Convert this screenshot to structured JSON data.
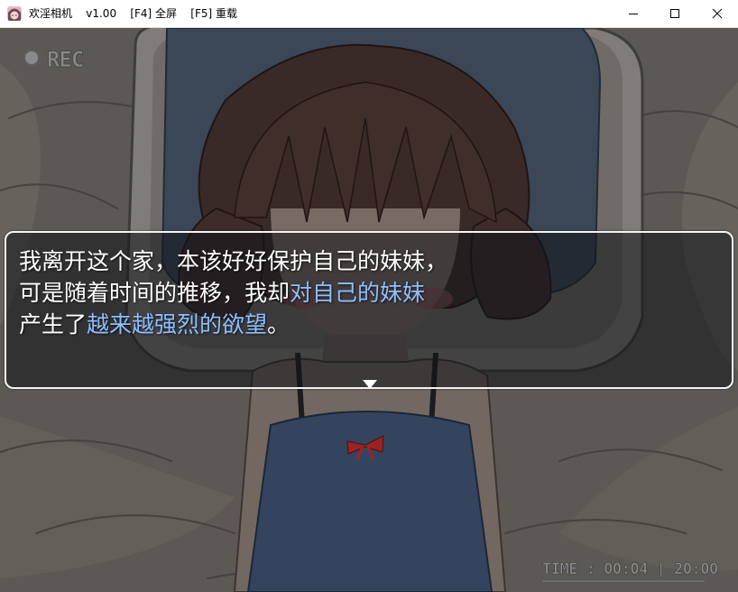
{
  "window": {
    "title": "欢淫相机    v1.00    [F4] 全屏    [F5] 重载",
    "controls": [
      "minimize",
      "maximize",
      "close"
    ],
    "app_icon": "anime-character-icon"
  },
  "hud": {
    "rec_indicator": "REC",
    "time_label": "TIME : 00:04 | 20:00"
  },
  "dialog": {
    "line1": "我离开这个家，本该好好保护自己的妹妹，",
    "line2_plain": "可是随着时间的推移，我却",
    "line2_highlight": "对自己的妹妹",
    "line3_plain_start": "产生了",
    "line3_highlight": "越来越强烈的欲望",
    "line3_plain_end": "。",
    "highlight_color": "#8fbfff",
    "advance_icon": "triangle-down-icon"
  },
  "colors": {
    "dialog_border": "#f4f4f4",
    "scene_tint": "#5a5650"
  }
}
